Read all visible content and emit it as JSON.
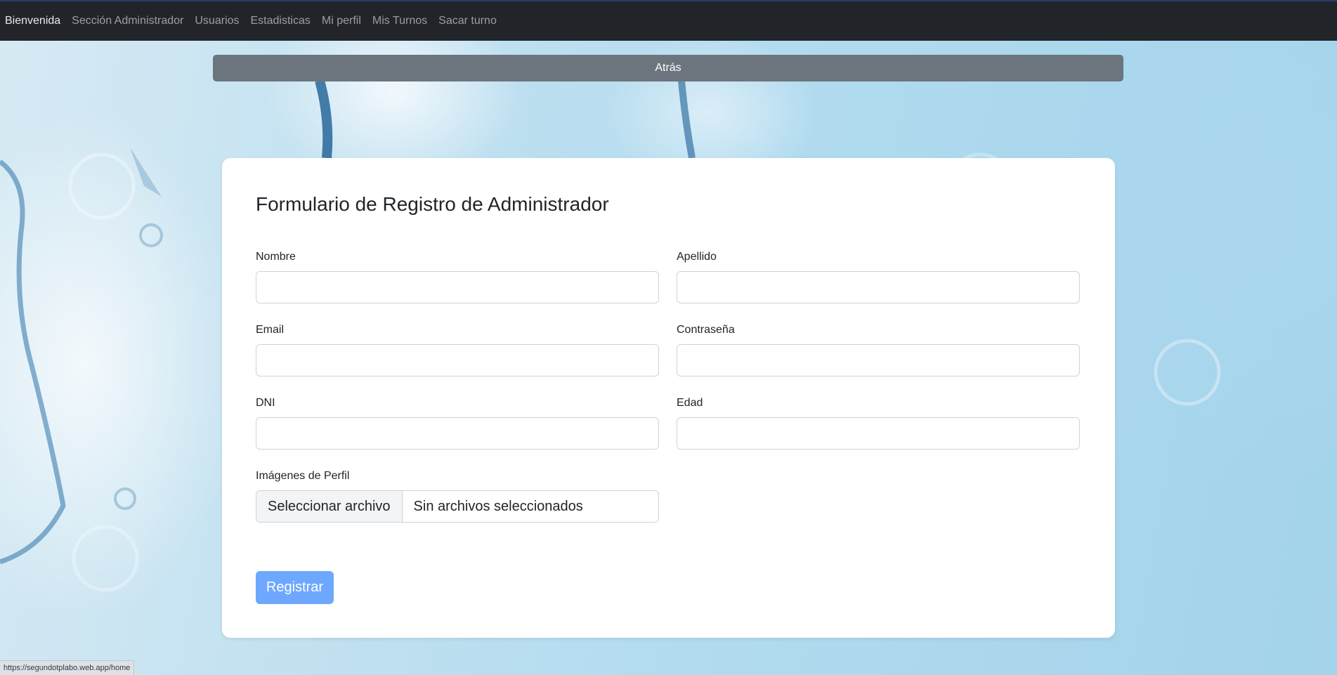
{
  "navbar": {
    "items": [
      {
        "label": "Bienvenida"
      },
      {
        "label": "Sección Administrador"
      },
      {
        "label": "Usuarios"
      },
      {
        "label": "Estadisticas"
      },
      {
        "label": "Mi perfil"
      },
      {
        "label": "Mis Turnos"
      },
      {
        "label": "Sacar turno"
      }
    ]
  },
  "back_button": {
    "label": "Atrás"
  },
  "form": {
    "title": "Formulario de Registro de Administrador",
    "fields": {
      "nombre": {
        "label": "Nombre",
        "value": ""
      },
      "apellido": {
        "label": "Apellido",
        "value": ""
      },
      "email": {
        "label": "Email",
        "value": ""
      },
      "contrasena": {
        "label": "Contraseña",
        "value": ""
      },
      "dni": {
        "label": "DNI",
        "value": ""
      },
      "edad": {
        "label": "Edad",
        "value": ""
      }
    },
    "images": {
      "label": "Imágenes de Perfil",
      "button_label": "Seleccionar archivo",
      "status": "Sin archivos seleccionados"
    },
    "submit_label": "Registrar"
  },
  "status_bar": {
    "url": "https://segundotplabo.web.app/home"
  },
  "colors": {
    "navbar": "#212529",
    "back_button": "#6c757d",
    "submit_button": "#6ea8fe",
    "background": "#a9d6ec"
  }
}
